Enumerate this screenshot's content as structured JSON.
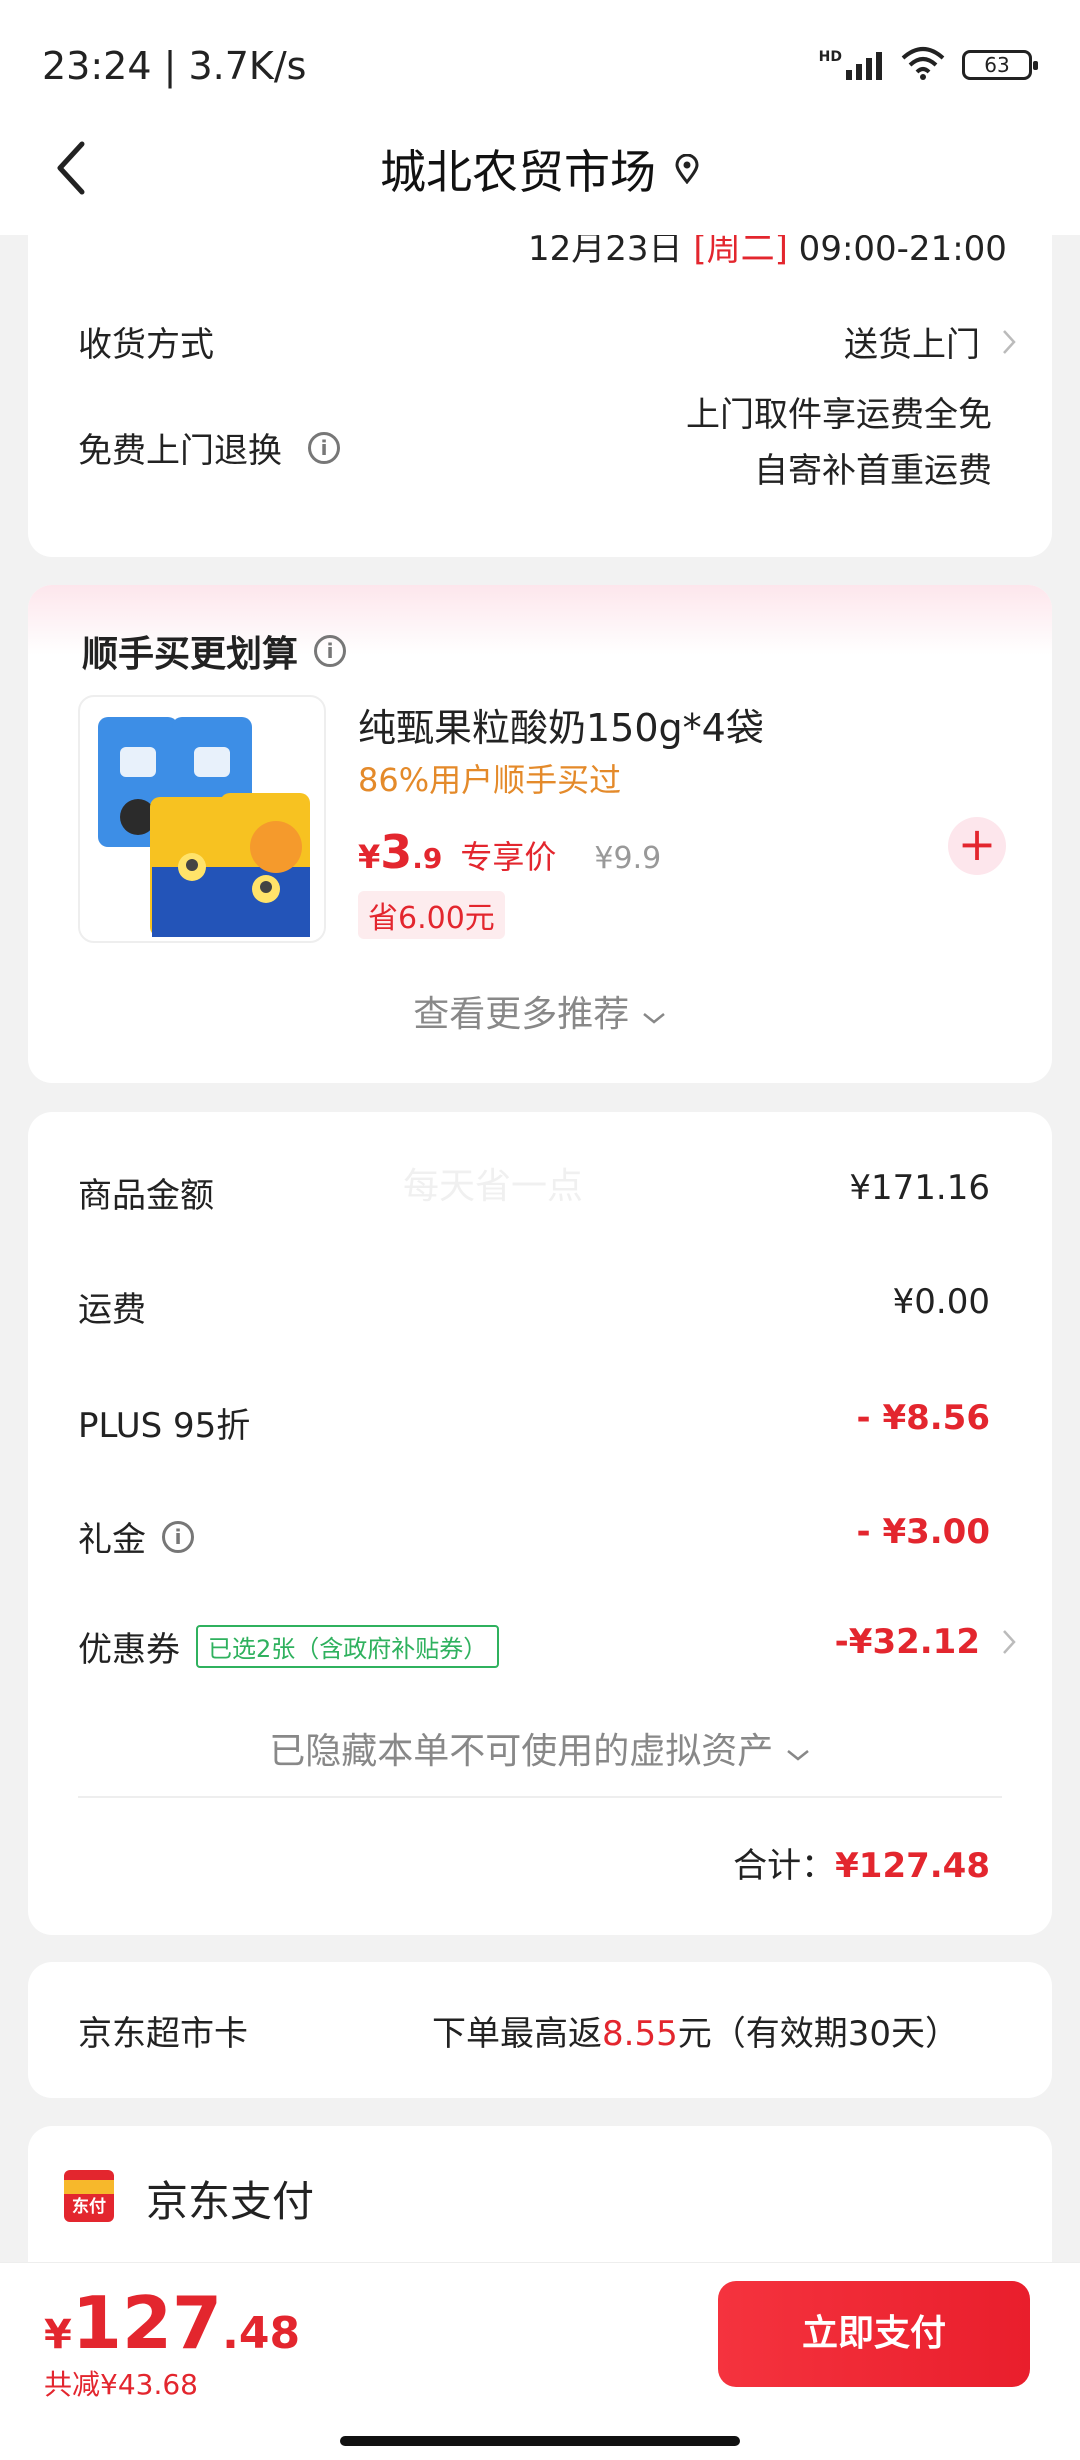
{
  "status_bar": {
    "time": "23:24 | 3.7K/s",
    "network_label": "HD",
    "battery": "63"
  },
  "nav": {
    "title": "城北农贸市场"
  },
  "delivery_card": {
    "cut_line_date": "12月23日 ",
    "cut_line_day": "[周二]",
    "cut_line_time": " 09:00-21:00",
    "method_label": "收货方式",
    "method_value": "送货上门",
    "return_label": "免费上门退换",
    "return_value_line1": "上门取件享运费全免",
    "return_value_line2": "自寄补首重运费"
  },
  "reco_card": {
    "title": "顺手买更划算",
    "product_name": "纯甄果粒酸奶150g*4袋",
    "product_sub": "86%用户顺手买过",
    "price_yen": "¥",
    "price_int": "3",
    "price_dec": ".9",
    "price_tag": "专享价",
    "price_old": "¥9.9",
    "save_badge": "省6.00元",
    "more_label": "查看更多推荐"
  },
  "amount_card": {
    "watermark": "每天省一点",
    "rows": [
      {
        "label": "商品金额",
        "value": "¥171.16"
      },
      {
        "label": "运费",
        "value": "¥0.00"
      },
      {
        "label": "PLUS 95折",
        "value": "- ¥8.56"
      },
      {
        "label": "礼金",
        "value": "- ¥3.00"
      },
      {
        "label": "优惠券",
        "value": "-¥32.12"
      }
    ],
    "coupon_badge": "已选2张（含政府补贴券）",
    "hidden_assets": "已隐藏本单不可使用的虚拟资产",
    "total_label": "合计：",
    "total_value": "¥127.48"
  },
  "jdcard": {
    "label": "京东超市卡",
    "value_prefix": "下单最高返",
    "value_amount": "8.55",
    "value_suffix": "元（有效期30天）"
  },
  "payment": {
    "icon_text": "东付",
    "name": "京东支付"
  },
  "bottom_bar": {
    "yen": "¥",
    "total_int": "127",
    "total_dec": ".48",
    "saved": "共减¥43.68",
    "pay_button": "立即支付"
  },
  "colors": {
    "accent_red": "#e3262e",
    "coupon_green": "#2fb15e",
    "hint_orange": "#e48a2a"
  }
}
